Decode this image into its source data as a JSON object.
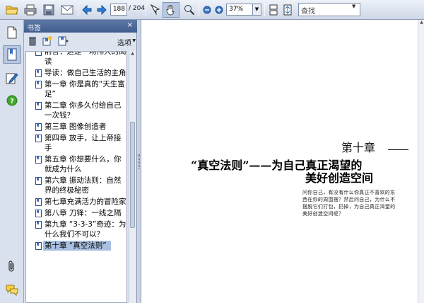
{
  "toolbar": {
    "page_current": "188",
    "page_total": "/ 204",
    "zoom": "37%",
    "zoom_dropdown": "▼",
    "search_placeholder": "查找",
    "search_dropdown": "▼"
  },
  "panel": {
    "title": "书签",
    "close": "×",
    "options_label": "选项",
    "options_arrow": "▼"
  },
  "bookmarks": [
    {
      "label": "前言：这是一场伟大的阅读"
    },
    {
      "label": "导读：做自己生活的主角"
    },
    {
      "label": "第一章 你是真的“天生富足”"
    },
    {
      "label": "第二章 你多久付给自己一次钱？"
    },
    {
      "label": "第三章 图像创造者"
    },
    {
      "label": "第四章 放手，让上帝接手"
    },
    {
      "label": "第五章 你想要什么，你就成为什么"
    },
    {
      "label": "第六章 振动法则：自然界的终极秘密"
    },
    {
      "label": "第七章充满活力的冒险家"
    },
    {
      "label": "第八章 刀锋：一线之隔"
    },
    {
      "label": "第九章 “3-3-3”奇迹：为什么我们不可以？"
    },
    {
      "label": "第十章 “真空法则”"
    }
  ],
  "document": {
    "chapter_number": "第十章",
    "title_line1": "“真空法则”——为自己真正渴望的",
    "title_line2": "美好创造空间",
    "intro": "问你自己，有没有什么你真正不喜欢的东西在你的周围摆？然后问自己，为什么不摆脱它们打包，扔掉，为自己真正渴望的美好创造空间呢？"
  },
  "icons": {
    "toolbar": [
      "open-folder-icon",
      "print-icon",
      "save-icon",
      "email-icon",
      "previous-page-icon",
      "next-page-icon",
      "select-text-icon",
      "hand-tool-icon",
      "zoom-marquee-icon",
      "zoom-out-icon",
      "zoom-in-icon",
      "single-page-icon",
      "fit-page-icon"
    ],
    "sidebar": [
      "pages-icon",
      "bookmarks-icon",
      "signatures-icon",
      "help-icon",
      "attachments-icon",
      "comments-icon"
    ]
  }
}
